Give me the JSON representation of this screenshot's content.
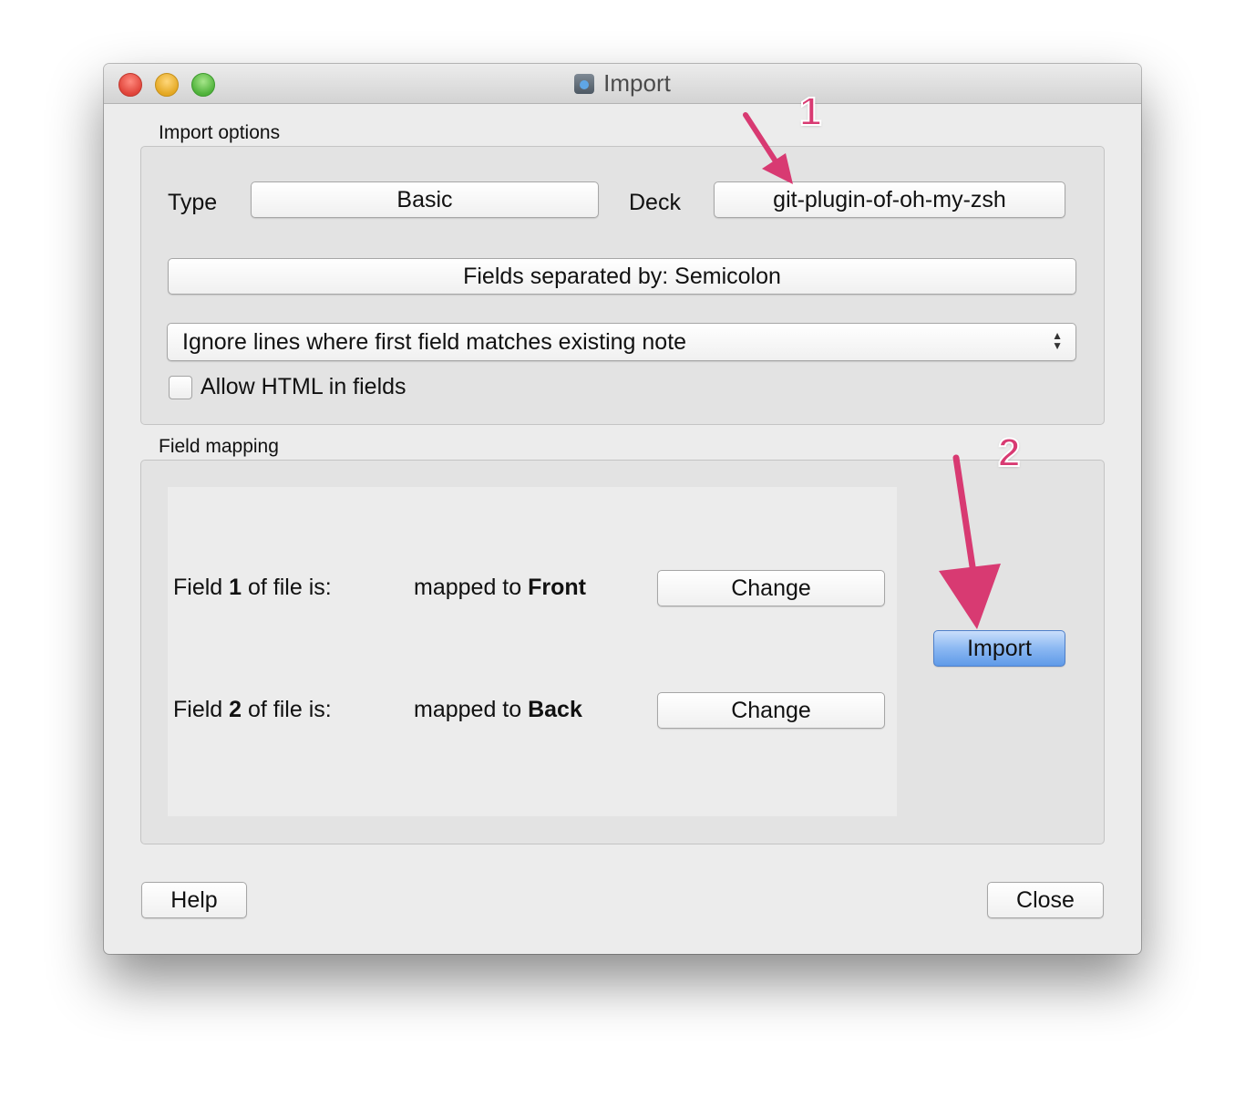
{
  "window": {
    "title": "Import"
  },
  "import_options": {
    "label": "Import options",
    "type_label": "Type",
    "type_value": "Basic",
    "deck_label": "Deck",
    "deck_value": "git-plugin-of-oh-my-zsh",
    "separator_button": "Fields separated by: Semicolon",
    "duplicate_policy": "Ignore lines where first field matches existing note",
    "allow_html_label": "Allow HTML in fields",
    "allow_html_checked": false
  },
  "field_mapping": {
    "label": "Field mapping",
    "rows": [
      {
        "field_prefix": "Field ",
        "field_num": "1",
        "field_suffix": " of file is:",
        "mapped_prefix": "mapped to ",
        "mapped_target": "Front",
        "change_label": "Change"
      },
      {
        "field_prefix": "Field ",
        "field_num": "2",
        "field_suffix": " of file is:",
        "mapped_prefix": "mapped to ",
        "mapped_target": "Back",
        "change_label": "Change"
      }
    ],
    "import_button": "Import"
  },
  "footer": {
    "help_button": "Help",
    "close_button": "Close"
  },
  "annotations": {
    "marker_1": "1",
    "marker_2": "2"
  },
  "colors": {
    "annotation": "#d83a72",
    "primary_button": "#6aa3ee",
    "window_bg": "#ececec"
  }
}
